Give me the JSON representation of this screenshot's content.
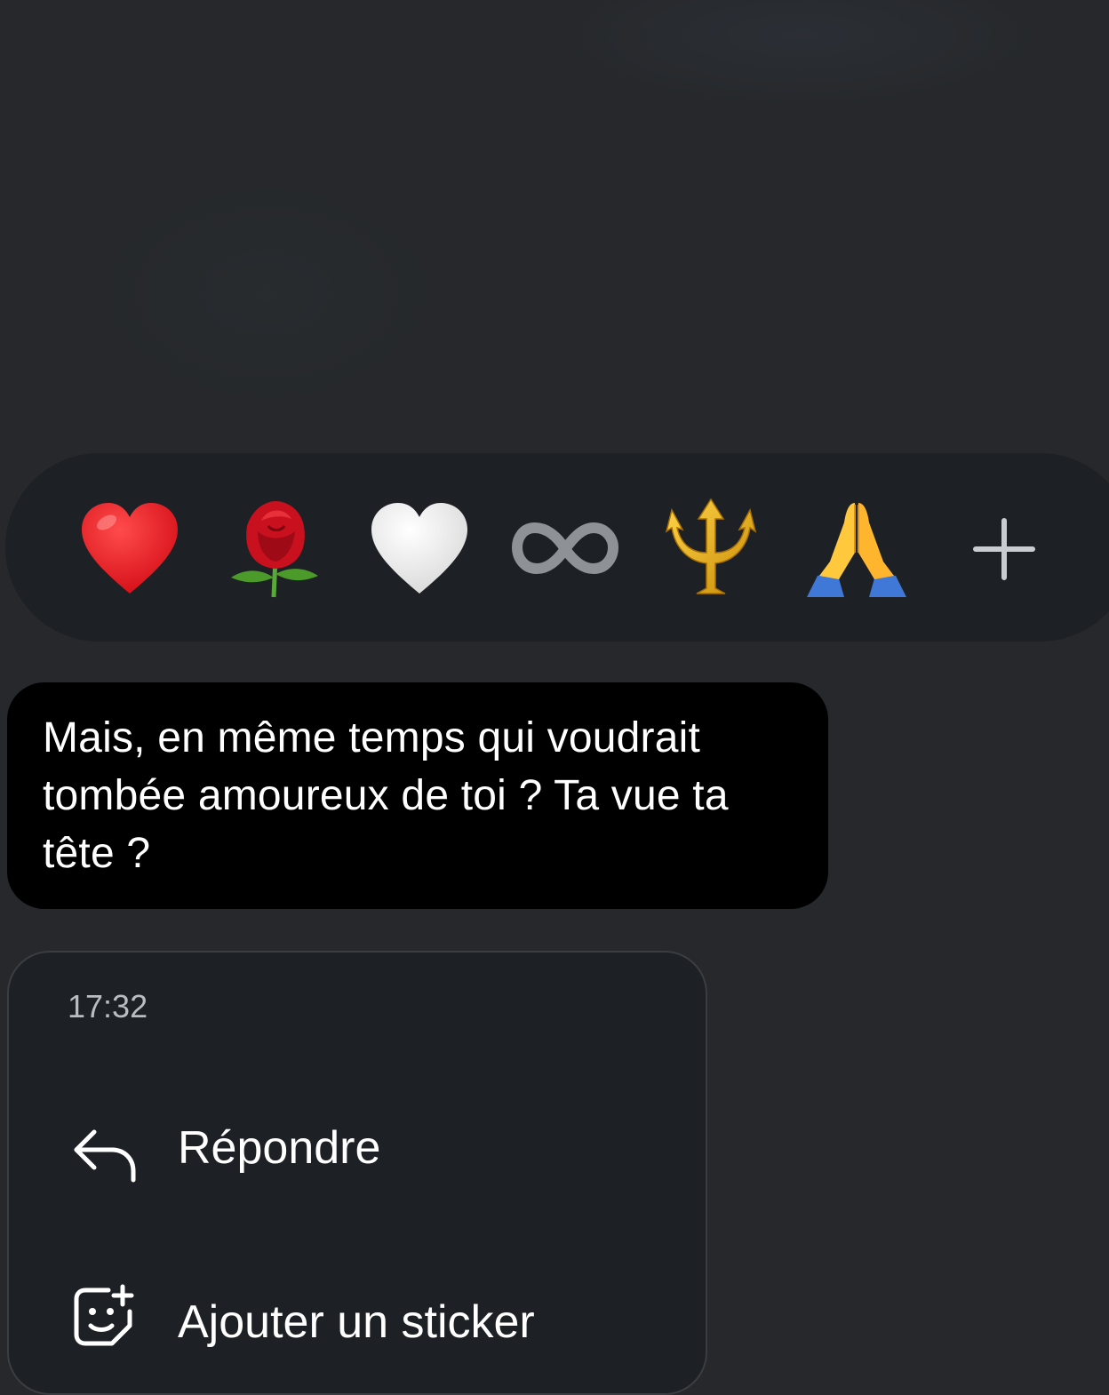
{
  "reactions": [
    {
      "name": "red-heart-icon",
      "label": "red heart"
    },
    {
      "name": "rose-icon",
      "label": "rose"
    },
    {
      "name": "white-heart-icon",
      "label": "white heart"
    },
    {
      "name": "infinity-icon",
      "label": "infinity"
    },
    {
      "name": "trident-icon",
      "label": "trident"
    },
    {
      "name": "folded-hands-icon",
      "label": "folded hands"
    },
    {
      "name": "plus-icon",
      "label": "more reactions"
    }
  ],
  "message": {
    "line1": "Mais, en même temps qui voudrait",
    "line2": "tombée amoureux de toi ? Ta vue ta",
    "line3": "tête ?"
  },
  "menu": {
    "timestamp": "17:32",
    "reply_label": "Répondre",
    "sticker_label": "Ajouter un sticker",
    "reply_icon": "reply-arrow-icon",
    "sticker_icon": "sticker-add-icon"
  },
  "colors": {
    "background": "#26282b",
    "reaction_bar": "#1d2024",
    "bubble": "#000000",
    "menu": "#1d2024",
    "timestamp": "#b9bcc1"
  }
}
